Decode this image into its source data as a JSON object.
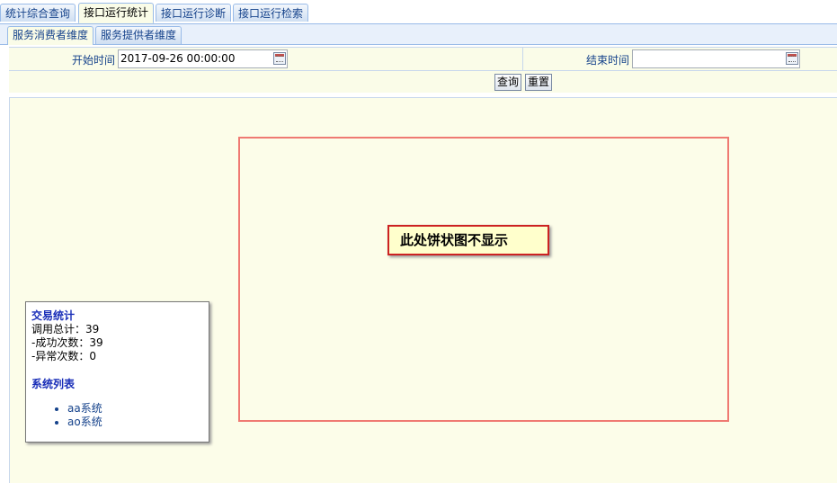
{
  "main_tabs": [
    {
      "label": "统计综合查询",
      "active": false
    },
    {
      "label": "接口运行统计",
      "active": true
    },
    {
      "label": "接口运行诊断",
      "active": false
    },
    {
      "label": "接口运行检索",
      "active": false
    }
  ],
  "corner_mark": "ˊ",
  "sub_tabs": [
    {
      "label": "服务消费者维度",
      "active": true
    },
    {
      "label": "服务提供者维度",
      "active": false
    }
  ],
  "form": {
    "start_label": "开始时间",
    "start_value": "2017-09-26 00:00:00",
    "end_label": "结束时间",
    "end_value": "",
    "query_button": "查询",
    "reset_button": "重置"
  },
  "stats": {
    "title": "交易统计",
    "total_calls": "调用总计：39",
    "success_count": "-成功次数：39",
    "error_count": "-异常次数：0",
    "systems_title": "系统列表",
    "systems": [
      "aa系统",
      "ao系统"
    ]
  },
  "chart": {
    "message": "此处饼状图不显示"
  },
  "colors": {
    "tab_text": "#15428b",
    "panel_bg": "#fcfde9",
    "chart_border": "#ef7a72",
    "message_border": "#cc2222",
    "stats_title": "#1a2fb8"
  }
}
